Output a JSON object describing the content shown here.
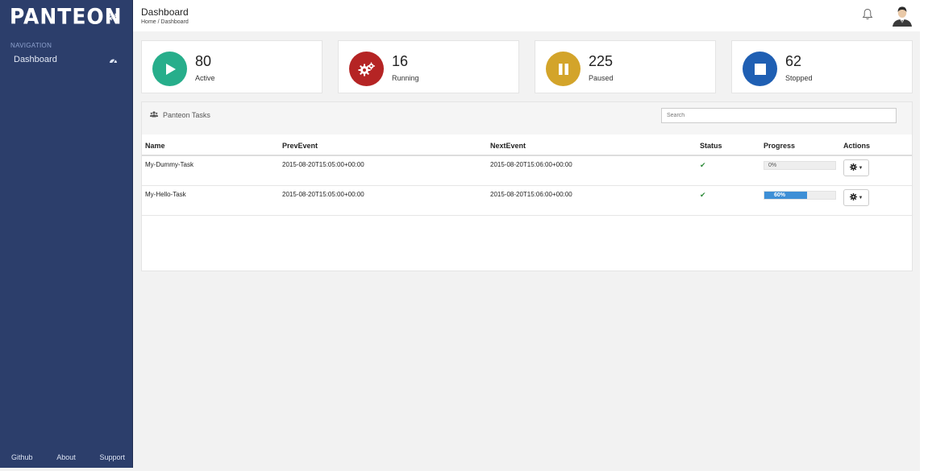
{
  "brand": {
    "logo_text": "PANTEON"
  },
  "sidebar": {
    "heading": "NAVIGATION",
    "items": [
      {
        "label": "Dashboard",
        "icon": "dashboard-icon"
      }
    ],
    "footer": [
      {
        "label": "Github"
      },
      {
        "label": "About"
      },
      {
        "label": "Support"
      }
    ]
  },
  "header": {
    "title": "Dashboard",
    "breadcrumb": {
      "home": "Home",
      "separator": "/",
      "current": "Dashboard"
    }
  },
  "stats": [
    {
      "value": "80",
      "label": "Active",
      "color": "#27ae8b",
      "icon": "play-icon"
    },
    {
      "value": "16",
      "label": "Running",
      "color": "#b52424",
      "icon": "gears-icon"
    },
    {
      "value": "225",
      "label": "Paused",
      "color": "#d3a42a",
      "icon": "pause-icon"
    },
    {
      "value": "62",
      "label": "Stopped",
      "color": "#1f5fb3",
      "icon": "stop-icon"
    }
  ],
  "tasks_panel": {
    "title": "Panteon Tasks",
    "search_placeholder": "Search",
    "columns": [
      "Name",
      "PrevEvent",
      "NextEvent",
      "Status",
      "Progress",
      "Actions"
    ],
    "rows": [
      {
        "name": "My-Dummy-Task",
        "prev_event": "2015-08-20T15:05:00+00:00",
        "next_event": "2015-08-20T15:06:00+00:00",
        "status": "✔",
        "progress": 0,
        "progress_label": "0%"
      },
      {
        "name": "My-Hello-Task",
        "prev_event": "2015-08-20T15:05:00+00:00",
        "next_event": "2015-08-20T15:06:00+00:00",
        "status": "✔",
        "progress": 60,
        "progress_label": "60%"
      }
    ]
  }
}
